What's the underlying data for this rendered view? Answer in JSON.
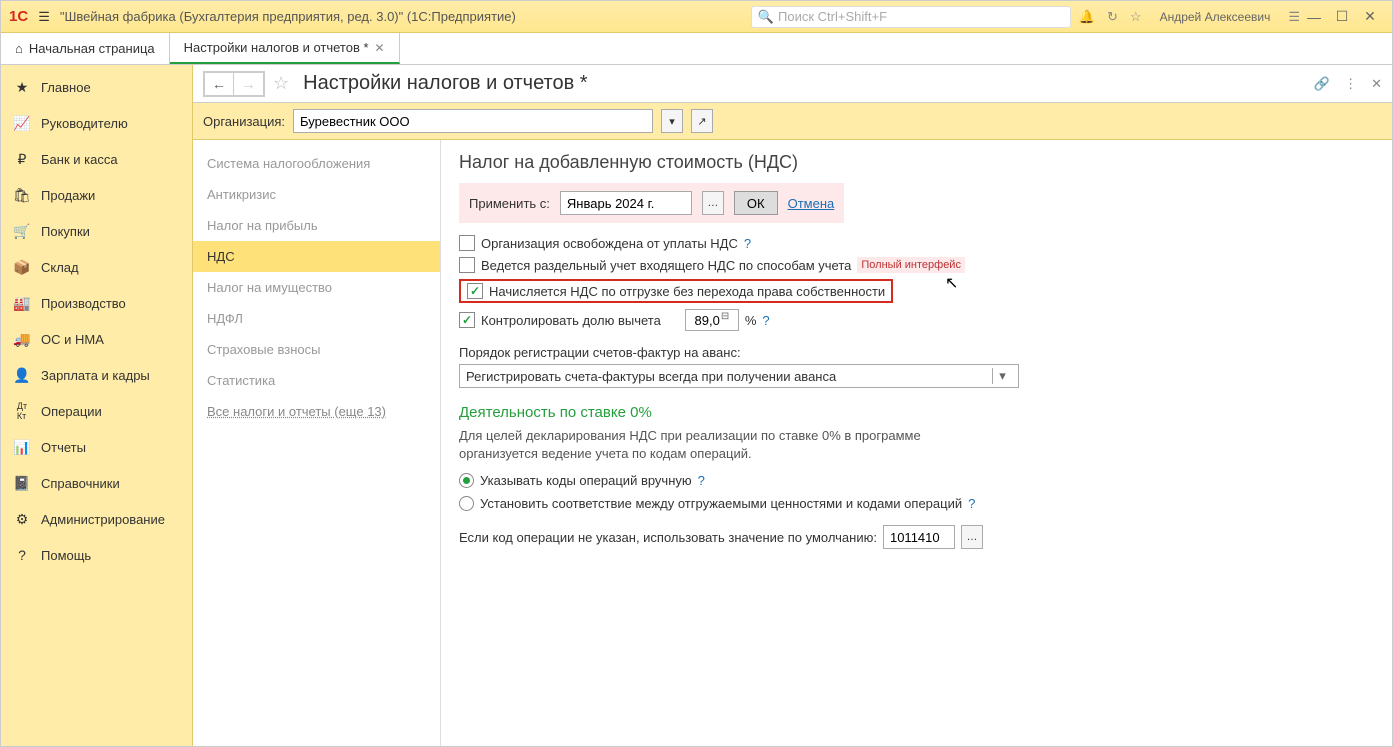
{
  "titlebar": {
    "logo_text": "1С",
    "app_title": "\"Швейная фабрика (Бухгалтерия предприятия, ред. 3.0)\"  (1С:Предприятие)",
    "search_placeholder": "Поиск Ctrl+Shift+F",
    "user": "Андрей Алексеевич"
  },
  "tabs": {
    "home": "Начальная страница",
    "active": "Настройки налогов и отчетов *"
  },
  "sidebar": [
    "Главное",
    "Руководителю",
    "Банк и касса",
    "Продажи",
    "Покупки",
    "Склад",
    "Производство",
    "ОС и НМА",
    "Зарплата и кадры",
    "Операции",
    "Отчеты",
    "Справочники",
    "Администрирование",
    "Помощь"
  ],
  "page": {
    "title": "Настройки налогов и отчетов *",
    "org_label": "Организация:",
    "org_value": "Буревестник ООО"
  },
  "settings_nav": [
    "Система налогообложения",
    "Антикризис",
    "Налог на прибыль",
    "НДС",
    "Налог на имущество",
    "НДФЛ",
    "Страховые взносы",
    "Статистика",
    "Все налоги и отчеты (еще 13)"
  ],
  "panel": {
    "heading": "Налог на добавленную стоимость (НДС)",
    "apply_from_label": "Применить с:",
    "apply_from_value": "Январь 2024 г.",
    "ok": "ОК",
    "cancel": "Отмена",
    "chk1": "Организация освобождена от уплаты НДС",
    "chk2": "Ведется раздельный учет входящего НДС по способам учета",
    "chk2_badge": "Полный интерфейс",
    "chk3": "Начисляется НДС по отгрузке без перехода права собственности",
    "chk4": "Контролировать долю вычета",
    "deduction_share": "89,0",
    "pct": "%",
    "invoice_label": "Порядок регистрации счетов-фактур на аванс:",
    "invoice_value": "Регистрировать счета-фактуры всегда при получении аванса",
    "zero_heading": "Деятельность по ставке 0%",
    "zero_desc": "Для целей декларирования НДС при реализации по ставке 0% в программе организуется ведение учета по кодам операций.",
    "radio1": "Указывать коды операций вручную",
    "radio2": "Установить соответствие между отгружаемыми ценностями и кодами операций",
    "default_code_label": "Если код операции не указан, использовать значение по умолчанию:",
    "default_code_value": "1011410"
  }
}
